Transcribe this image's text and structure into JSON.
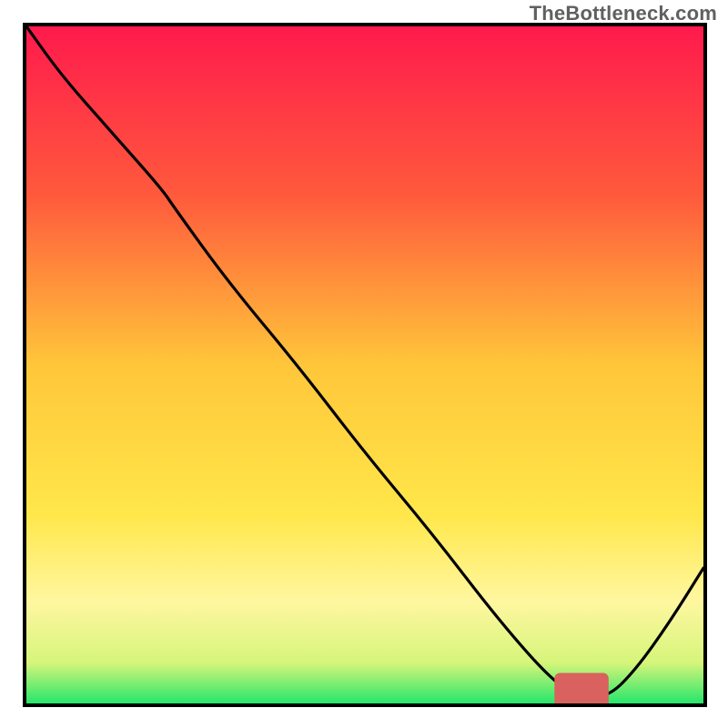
{
  "watermark": "TheBottleneck.com",
  "chart_data": {
    "type": "line",
    "title": "",
    "xlabel": "",
    "ylabel": "",
    "xlim": [
      0,
      100
    ],
    "ylim": [
      0,
      100
    ],
    "series": [
      {
        "name": "curve",
        "x": [
          0,
          5,
          12,
          20,
          22,
          30,
          40,
          50,
          60,
          70,
          78,
          82,
          86,
          90,
          95,
          100
        ],
        "y": [
          100,
          93,
          85,
          76,
          73,
          62,
          50,
          37,
          25,
          12,
          3,
          1,
          1,
          5,
          12,
          20
        ]
      }
    ],
    "optimal_bar": {
      "x_start": 78,
      "x_end": 86,
      "y": 1.5,
      "color": "#d9625e",
      "thickness": 2
    },
    "gradient_stops": [
      {
        "offset": 0,
        "color": "#ff1a4d"
      },
      {
        "offset": 25,
        "color": "#ff5a3c"
      },
      {
        "offset": 50,
        "color": "#ffc63a"
      },
      {
        "offset": 72,
        "color": "#ffe74a"
      },
      {
        "offset": 85,
        "color": "#fff7a0"
      },
      {
        "offset": 94,
        "color": "#d6f57a"
      },
      {
        "offset": 100,
        "color": "#27e66b"
      }
    ]
  }
}
